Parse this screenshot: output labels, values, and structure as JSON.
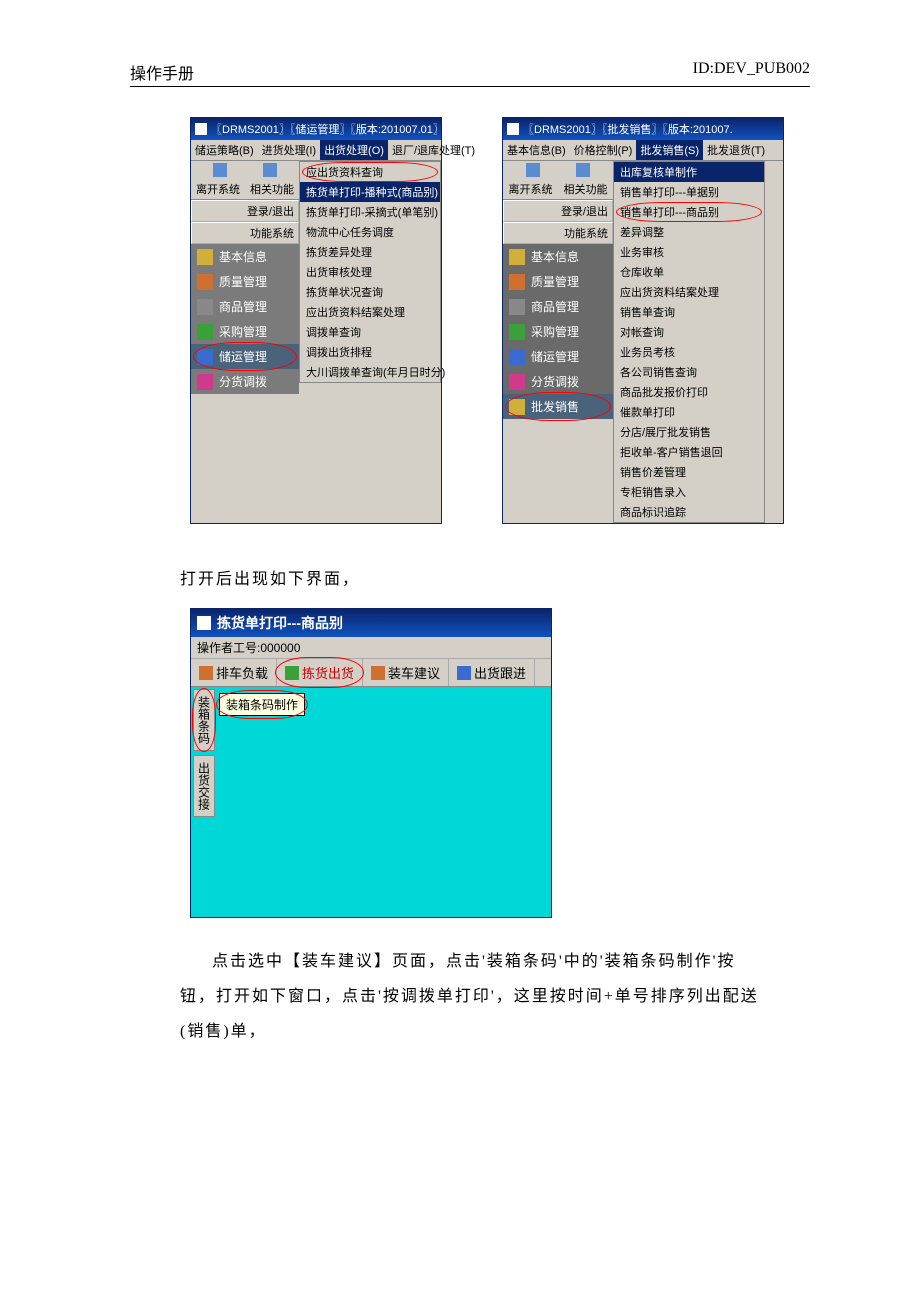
{
  "header": {
    "left": "操作手册",
    "right": "ID:DEV_PUB002"
  },
  "win1": {
    "title": "〖DRMS2001〗〖储运管理〗〖版本:201007.01〗〖",
    "menus": [
      "储运策略(B)",
      "进货处理(I)",
      "出货处理(O)",
      "退厂/退库处理(T)"
    ],
    "menu_hot_index": 2,
    "sys": {
      "leave": "离开系统",
      "func": "相关功能",
      "login": "登录/退出",
      "sys": "功能系统"
    },
    "nav": [
      "基本信息",
      "质量管理",
      "商品管理",
      "采购管理",
      "储运管理",
      "分货调拨"
    ],
    "nav_marked": 4,
    "dropdown": [
      "应出货资料查询",
      "拣货单打印-播种式(商品别)",
      "拣货单打印-采摘式(单笔别)",
      "物流中心任务调度",
      "拣货差异处理",
      "出货审核处理",
      "拣货单状况查询",
      "应出货资料结案处理",
      "调拨单查询",
      "调拨出货排程",
      "大川调拨单查询(年月日时分)"
    ],
    "dd_hl": 1
  },
  "win2": {
    "title": "〖DRMS2001〗〖批发销售〗〖版本:201007.",
    "menus": [
      "基本信息(B)",
      "价格控制(P)",
      "批发销售(S)",
      "批发退货(T)"
    ],
    "menu_hot_index": 2,
    "sys": {
      "leave": "离开系统",
      "func": "相关功能",
      "login": "登录/退出",
      "sys": "功能系统"
    },
    "nav": [
      "基本信息",
      "质量管理",
      "商品管理",
      "采购管理",
      "储运管理",
      "分货调拨",
      "批发销售"
    ],
    "nav_marked": 6,
    "dropdown": [
      "出库复核单制作",
      "销售单打印---单据别",
      "销售单打印---商品别",
      "差异调整",
      "业务审核",
      "仓库收单",
      "应出货资料结案处理",
      "销售单查询",
      "对帐查询",
      "业务员考核",
      "各公司销售查询",
      "商品批发报价打印",
      "催款单打印",
      "分店/展厅批发销售",
      "拒收单-客户销售退回",
      "销售价差管理",
      "专柜销售录入",
      "商品标识追踪"
    ],
    "dd_mark": 2
  },
  "para1": "打开后出现如下界面，",
  "win3": {
    "title": "拣货单打印---商品别",
    "operator": "操作者工号:000000",
    "tabs": [
      "排车负载",
      "拣货出货",
      "装车建议",
      "出货跟进"
    ],
    "tab_marked": 1,
    "vtabs": [
      "装箱条码",
      "出货交接"
    ],
    "vtab_marked": 0,
    "tooltip": "装箱条码制作"
  },
  "para2": "点击选中【装车建议】页面，点击'装箱条码'中的'装箱条码制作'按钮，打开如下窗口，点击'按调拨单打印'，这里按时间+单号排序列出配送(销售)单，"
}
